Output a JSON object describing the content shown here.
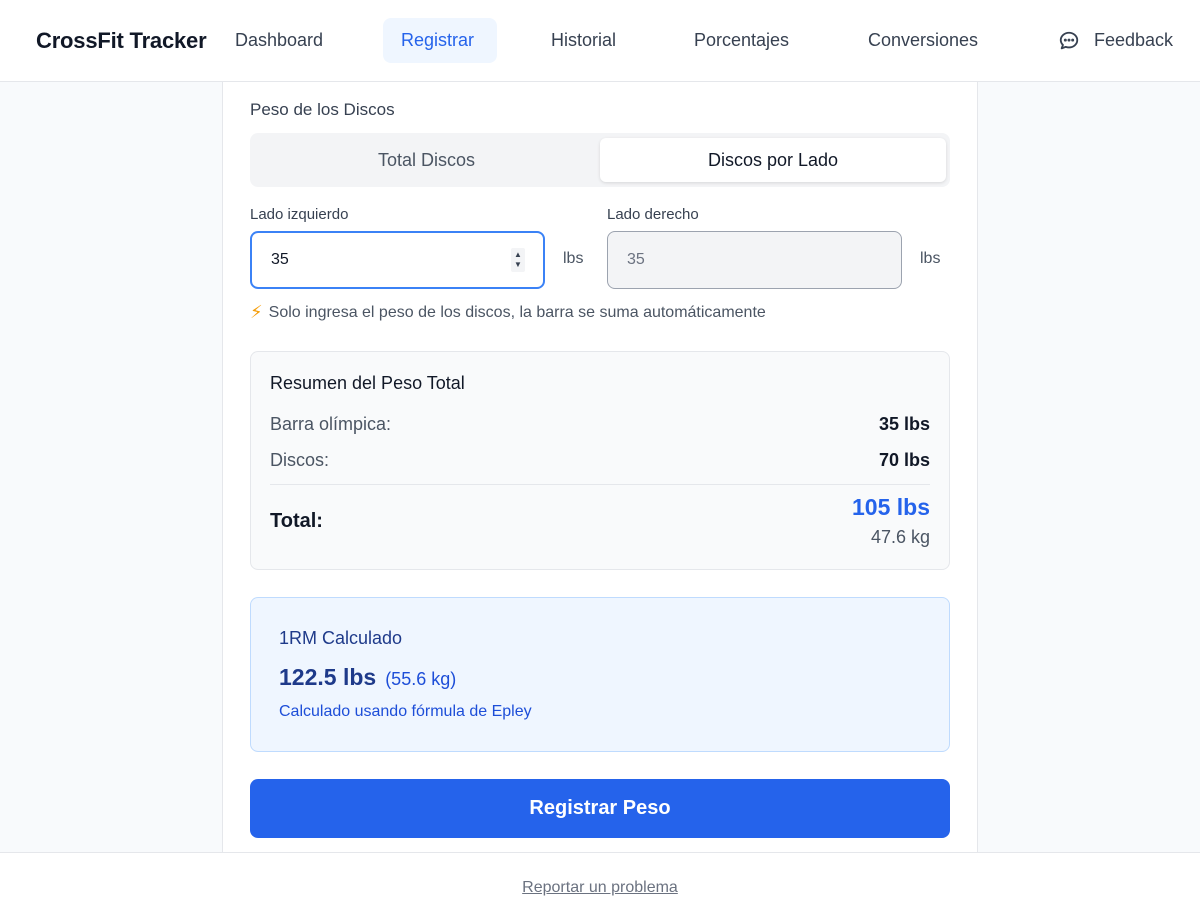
{
  "header": {
    "brand": "CrossFit Tracker",
    "nav": [
      "Dashboard",
      "Registrar",
      "Historial",
      "Porcentajes",
      "Conversiones"
    ],
    "active_nav": "Registrar",
    "feedback_label": "Feedback",
    "feedback_icon": "chat-bubble-icon"
  },
  "form": {
    "section_label": "Peso de los Discos",
    "toggle": {
      "total_label": "Total Discos",
      "lado_label": "Discos por Lado",
      "selected": "Discos por Lado"
    },
    "left": {
      "label": "Lado izquierdo",
      "value": "35",
      "unit": "lbs"
    },
    "right": {
      "label": "Lado derecho",
      "value": "35",
      "unit": "lbs"
    },
    "hint_icon": "⚡",
    "hint": "Solo ingresa el peso de los discos, la barra se suma automáticamente"
  },
  "summary": {
    "title": "Resumen del Peso Total",
    "bar_label": "Barra olímpica:",
    "bar_value": "35 lbs",
    "plates_label": "Discos:",
    "plates_value": "70 lbs",
    "total_label": "Total:",
    "total_lbs": "105 lbs",
    "total_kg": "47.6 kg"
  },
  "one_rm": {
    "title": "1RM Calculado",
    "value_lbs": "122.5 lbs",
    "value_kg": "(55.6 kg)",
    "note": "Calculado usando fórmula de Epley"
  },
  "submit_label": "Registrar Peso",
  "footer": {
    "report_link": "Reportar un problema"
  },
  "colors": {
    "accent": "#2563eb",
    "accent_light": "#eff6ff",
    "text_dark": "#111827"
  }
}
